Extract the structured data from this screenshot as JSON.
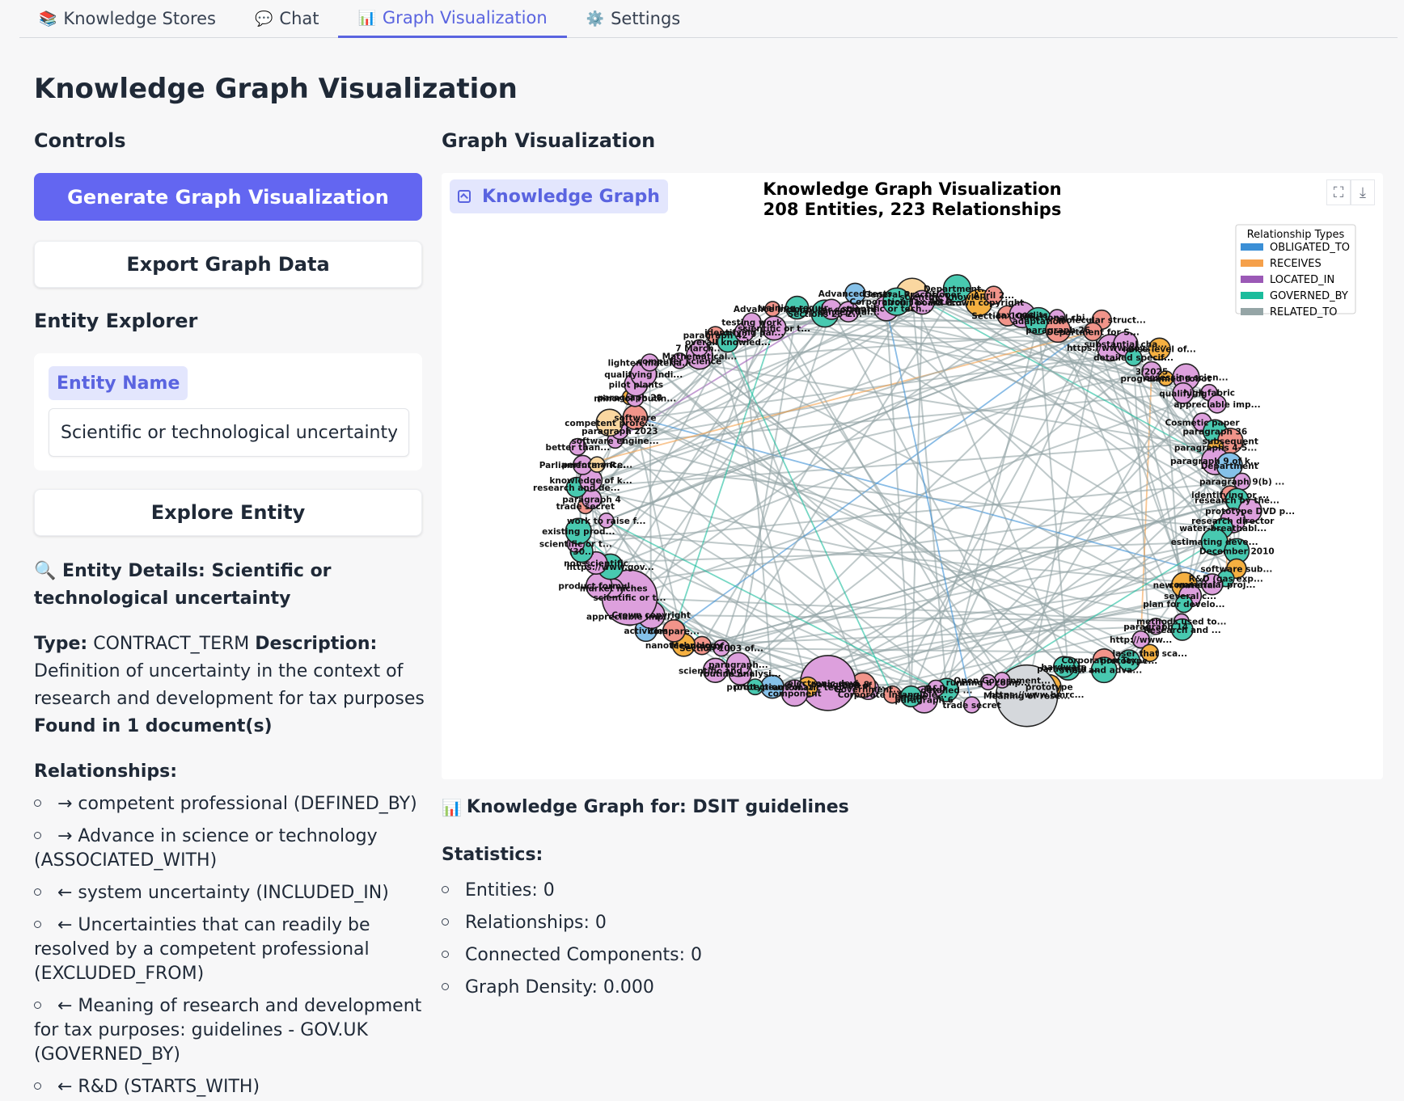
{
  "tabs": [
    {
      "icon": "📚",
      "label": "Knowledge Stores"
    },
    {
      "icon": "💬",
      "label": "Chat"
    },
    {
      "icon": "📊",
      "label": "Graph Visualization"
    },
    {
      "icon": "⚙️",
      "label": "Settings"
    }
  ],
  "page_title": "Knowledge Graph Visualization",
  "controls": {
    "heading": "Controls",
    "generate_label": "Generate Graph Visualization",
    "export_label": "Export Graph Data"
  },
  "entity_explorer": {
    "heading": "Entity Explorer",
    "field_label": "Entity Name",
    "field_value": "Scientific or technological uncertainty",
    "explore_label": "Explore Entity"
  },
  "entity_details": {
    "heading": "🔍 Entity Details: Scientific or technological uncertainty",
    "type_label": "Type:",
    "type_value": "CONTRACT_TERM",
    "description_label": "Description:",
    "description_value": "Definition of uncertainty in the context of research and development for tax purposes",
    "found_in": "Found in 1 document(s)",
    "relationships_heading": "Relationships:",
    "relationships": [
      "→ competent professional (DEFINED_BY)",
      "→ Advance in science or technology (ASSOCIATED_WITH)",
      "← system uncertainty (INCLUDED_IN)",
      "← Uncertainties that can readily be resolved by a competent professional (EXCLUDED_FROM)",
      "← Meaning of research and development for tax purposes: guidelines - GOV.UK (GOVERNED_BY)",
      "← R&D (STARTS_WITH)"
    ]
  },
  "graph_section": {
    "heading": "Graph Visualization",
    "badge_label": "Knowledge Graph",
    "icons": [
      "fullscreen-icon",
      "download-icon"
    ]
  },
  "chart_data": {
    "type": "network",
    "title": "Knowledge Graph Visualization",
    "subtitle": "208 Entities, 223 Relationships",
    "entity_count": 208,
    "relationship_count": 223,
    "legend_title": "Relationship Types",
    "legend_placement": "top-right",
    "relationship_types": [
      {
        "name": "OBLIGATED_TO",
        "color": "#3b8fd6"
      },
      {
        "name": "RECEIVES",
        "color": "#f5a04a"
      },
      {
        "name": "LOCATED_IN",
        "color": "#9b59b6"
      },
      {
        "name": "GOVERNED_BY",
        "color": "#1abc9c"
      },
      {
        "name": "RELATED_TO",
        "color": "#95a5a6"
      }
    ],
    "node_colors": [
      "#dda0dd",
      "#48c9b0",
      "#f5b041",
      "#f1948a",
      "#85c1e9",
      "#fad7a0"
    ],
    "node_labels": [
      "General Practitioner",
      "circuit board d...",
      "scientific knowle...",
      "Department...",
      "© Crown copyright",
      "April 2...",
      "Section 1006...",
      "tax credits",
      "adaptation",
      "functional chi...",
      "paragraph 26",
      "molecular struct...",
      "Department for S...",
      "https://www.gov...",
      "substantial cha...",
      "detailed specif...",
      "noise level of...",
      "3/2025",
      "programmed robot",
      "assessing scien...",
      "qualifying",
      "high fabric",
      "appreciable imp...",
      "Cosmetic paper",
      "paragraph 36",
      "subsequent",
      "paragraphs 4-5...",
      "paragraph 9 of k...",
      "Department",
      "paragraph 9(b) ...",
      "identifying or ...",
      "research by the...",
      "prototype DVD p...",
      "research director",
      "water-breathabl...",
      "estimating deve...",
      "December 2010",
      "software sub...",
      "R&D (gas exp...",
      "commercial proj...",
      "new material",
      "several c...",
      "plan for develo...",
      "methods used to...",
      "Research and ...",
      "paragraph 14",
      "http://www...",
      "laser that sca...",
      "prototype...",
      "Corporation Tax...",
      "new and adva...",
      "paragraph ...",
      "hardware",
      "prototype",
      "https://www.hmrc...",
      "Meaning of rese...",
      "Open Government...",
      "running a comp...",
      "trade secret",
      "detailed ...",
      "R&D",
      "paragraph 6",
      "engine",
      "Corporate Intangible...",
      "Government...",
      "End of ...",
      "paragraph 8",
      "electronic devi...",
      "automatic test",
      "component",
      "protection Pol...",
      "prototype...",
      "routine analysi...",
      "paragraph...",
      "scientific and...",
      "Section 1003 of...",
      "Meaning of...",
      "nanotechnology",
      "compare...",
      "activities",
      "Crown copyright",
      "appreciable imp...",
      "scientific or t...",
      "market niches",
      "product formul...",
      "https://www.gov...",
      "non-scientific",
      "(30...",
      "scientific or t...",
      "existing prod...",
      "work to raise f...",
      "trade secret",
      "paragraph 4",
      "research and de...",
      "knowledge of k...",
      "Parliamentary R...",
      "performance...",
      "better than...",
      "software engine...",
      "paragraph 2023",
      "competent profe...",
      "software",
      "paragraph 28",
      "minor or routin...",
      "pilot plants",
      "qualifying indi...",
      "lighten materia...",
      "computer science",
      "Mathematical...",
      "7 March...",
      "paragraph 42",
      "overall knowled...",
      "identifying par...",
      "testing work",
      "scientific or t...",
      "Advance in sci...",
      "training requir...",
      "Sections 23-2...",
      "computer software",
      "conceptual...",
      "Advanced tests",
      "scientific or tech...",
      "Corporation Tax Act"
    ]
  },
  "stats": {
    "title_icon": "📊",
    "title": "Knowledge Graph for: DSIT guidelines",
    "heading": "Statistics:",
    "items": [
      "Entities: 0",
      "Relationships: 0",
      "Connected Components: 0",
      "Graph Density: 0.000"
    ]
  }
}
